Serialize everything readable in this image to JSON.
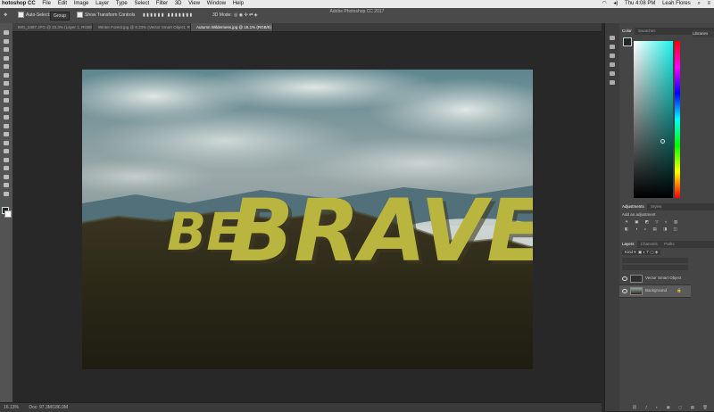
{
  "menubar": {
    "app": "hotoshop CC",
    "items": [
      "File",
      "Edit",
      "Image",
      "Layer",
      "Type",
      "Select",
      "Filter",
      "3D",
      "View",
      "Window",
      "Help"
    ],
    "clock": "Thu 4:08 PM",
    "user": "Leah Flores"
  },
  "window_title": "Adobe Photoshop CC 2017",
  "options": {
    "auto_select_label": "Auto-Select:",
    "auto_select_value": "Group",
    "transform_label": "Show Transform Controls",
    "mode_label": "3D Mode:"
  },
  "tabs": [
    {
      "label": "IMG_5487.JPG @ 33.3% (Layer 1, RGB/8*)",
      "active": false
    },
    {
      "label": "Winter Forest.jpg @ 8.33% (Vector Smart Object, RGB/8)",
      "active": false
    },
    {
      "label": "Autumn Wilderness.jpg @ 16.1% (RGB/8)",
      "active": true
    }
  ],
  "canvas": {
    "headline_part1": "BE",
    "headline_part2": "BRAVE",
    "accent": "#b9b53e"
  },
  "status": {
    "zoom": "16.13%",
    "doc": "Doc: 97.3M/186.9M"
  },
  "panels": {
    "color_tabs": [
      "Color",
      "Swatches"
    ],
    "libraries_label": "Libraries",
    "adjust_tabs": [
      "Adjustments",
      "Styles"
    ],
    "adjust_hint": "Add an adjustment",
    "layers_tabs": [
      "Layers",
      "Channels",
      "Paths"
    ],
    "kind_label": "Kind",
    "layers": [
      {
        "name": "Vector Smart Object",
        "selected": false
      },
      {
        "name": "Background",
        "selected": true
      }
    ]
  }
}
